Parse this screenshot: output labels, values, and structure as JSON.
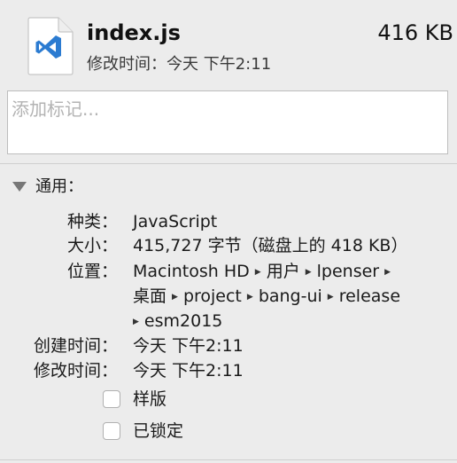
{
  "file": {
    "name": "index.js",
    "size": "416 KB",
    "modified_label": "修改时间：",
    "modified_value": "今天 下午2:11",
    "icon": "vscode-file-icon",
    "icon_color": "#2b7bd1"
  },
  "tags": {
    "placeholder": "添加标记..."
  },
  "general": {
    "title": "通用：",
    "kind_label": "种类：",
    "kind_value": "JavaScript",
    "size_label": "大小：",
    "size_value": "415,727 字节（磁盘上的 418 KB）",
    "where_label": "位置：",
    "path": [
      "Macintosh HD",
      "用户",
      "lpenser",
      "桌面",
      "project",
      "bang-ui",
      "release",
      "esm2015"
    ],
    "created_label": "创建时间：",
    "created_value": "今天 下午2:11",
    "modified_label": "修改时间：",
    "modified_value": "今天 下午2:11",
    "stationery_label": "样版",
    "stationery_checked": false,
    "locked_label": "已锁定",
    "locked_checked": false
  }
}
